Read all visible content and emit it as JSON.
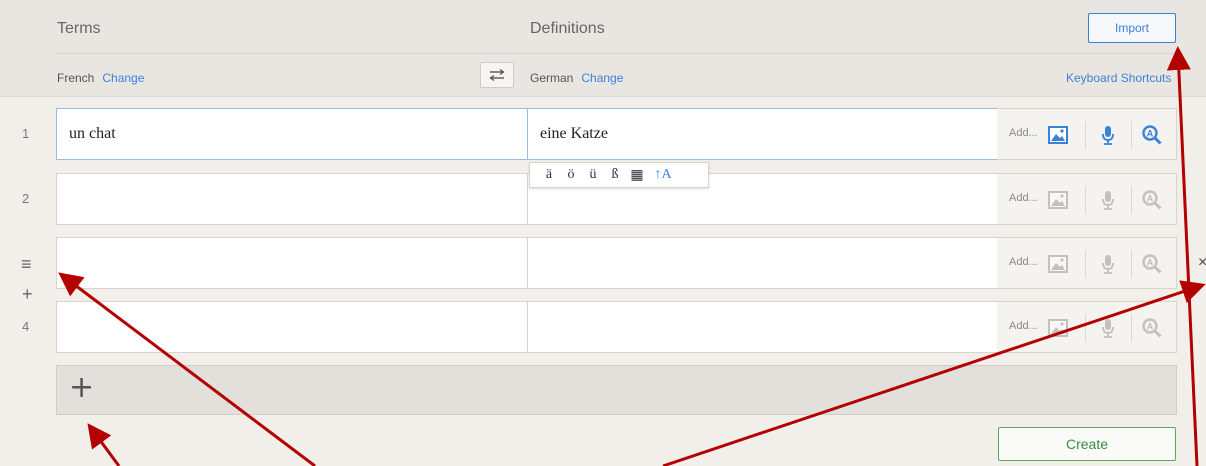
{
  "header": {
    "terms_title": "Terms",
    "definitions_title": "Definitions",
    "term_language": "French",
    "definition_language": "German",
    "change_label": "Change",
    "import_label": "Import",
    "shortcuts_label": "Keyboard Shortcuts"
  },
  "rows": [
    {
      "number": "1",
      "term": "un chat",
      "definition": "eine Katze",
      "add_label": "Add..."
    },
    {
      "number": "2",
      "term": "",
      "definition": "",
      "add_label": "Add..."
    },
    {
      "number": "",
      "term": "",
      "definition": "",
      "add_label": "Add..."
    },
    {
      "number": "4",
      "term": "",
      "definition": "",
      "add_label": "Add..."
    }
  ],
  "accent_chars": [
    "ä",
    "ö",
    "ü",
    "ß",
    "▦",
    "↑A"
  ],
  "side_controls": {
    "drag": "≡",
    "insert": "+",
    "delete": "×"
  },
  "add_row_label": "+",
  "create_label": "Create",
  "colors": {
    "accent_blue": "#3b82d6",
    "create_green": "#3a8c3f",
    "annotation_red": "#b30000"
  },
  "icons": [
    "swap-languages-icon",
    "image-icon",
    "microphone-icon",
    "search-icon",
    "drag-handle-icon",
    "insert-row-icon",
    "delete-row-icon",
    "plus-icon"
  ]
}
